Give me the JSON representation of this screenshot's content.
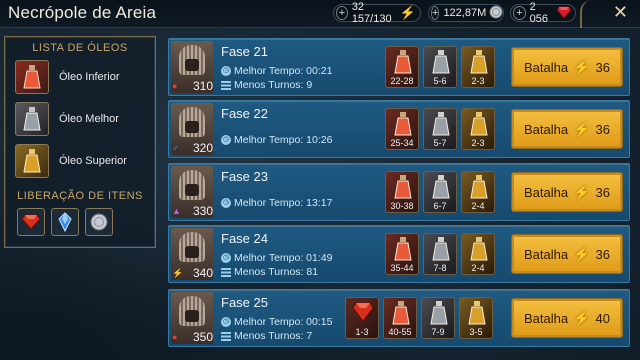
{
  "header": {
    "title": "Necrópole de Areia",
    "energy": "32 157/130",
    "silver": "122,87M",
    "gems": "2 056"
  },
  "colors": {
    "accent_gold": "#c8a868",
    "battle_button": "#f0b030",
    "stage_bg": "#1f5a82",
    "energy_icon": "#f4d020"
  },
  "left_panel": {
    "oils_heading": "LISTA DE ÓLEOS",
    "oils": [
      {
        "label": "Óleo Inferior",
        "icon": "lesser-oil-icon"
      },
      {
        "label": "Óleo Melhor",
        "icon": "greater-oil-icon"
      },
      {
        "label": "Óleo Superior",
        "icon": "superior-oil-icon"
      }
    ],
    "release_heading": "LIBERAÇÃO DE ITENS",
    "release_items": [
      "ruby-gem-icon",
      "blue-crystal-icon",
      "silver-coin-icon"
    ]
  },
  "stages": [
    {
      "name": "Fase 21",
      "level": "310",
      "best_time_label": "Melhor Tempo: 00:21",
      "min_turns_label": "Menos Turnos: 9",
      "drops": [
        "22-28",
        "5-6",
        "2-3"
      ],
      "battle_label": "Batalha",
      "energy_cost": "36"
    },
    {
      "name": "Fase 22",
      "level": "320",
      "best_time_label": "Melhor Tempo: 10:26",
      "min_turns_label": "",
      "drops": [
        "25-34",
        "5-7",
        "2-3"
      ],
      "battle_label": "Batalha",
      "energy_cost": "36"
    },
    {
      "name": "Fase 23",
      "level": "330",
      "best_time_label": "Melhor Tempo: 13:17",
      "min_turns_label": "",
      "drops": [
        "30-38",
        "6-7",
        "2-4"
      ],
      "battle_label": "Batalha",
      "energy_cost": "36"
    },
    {
      "name": "Fase 24",
      "level": "340",
      "best_time_label": "Melhor Tempo: 01:49",
      "min_turns_label": "Menos Turnos: 81",
      "drops": [
        "35-44",
        "7-8",
        "2-4"
      ],
      "battle_label": "Batalha",
      "energy_cost": "36"
    },
    {
      "name": "Fase 25",
      "level": "350",
      "best_time_label": "Melhor Tempo: 00:15",
      "min_turns_label": "Menos Turnos: 7",
      "drops": [
        "1-3",
        "40-55",
        "7-9",
        "3-5"
      ],
      "battle_label": "Batalha",
      "energy_cost": "40"
    }
  ]
}
